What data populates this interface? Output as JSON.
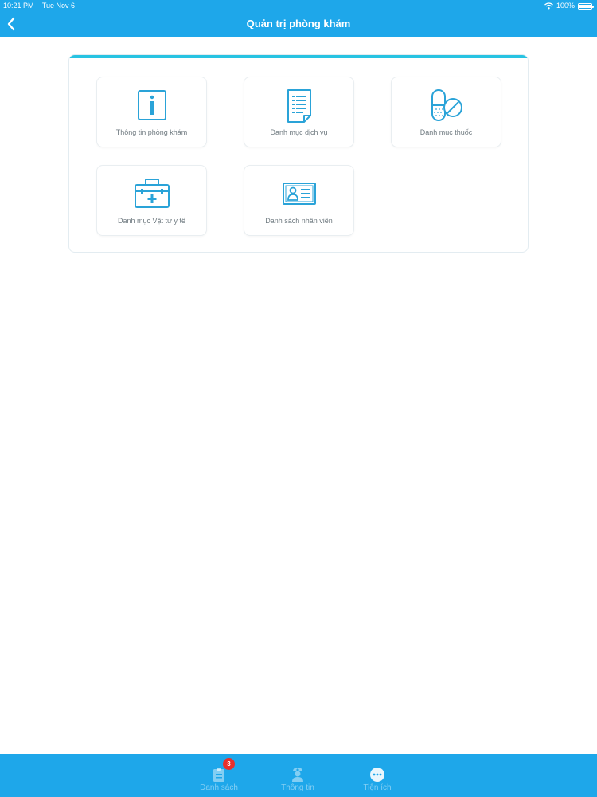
{
  "status": {
    "time": "10:21 PM",
    "date": "Tue Nov 6",
    "battery": "100%"
  },
  "header": {
    "title": "Quản trị phòng khám",
    "back_icon": "chevron-left-icon"
  },
  "colors": {
    "primary": "#1ea7ea",
    "accent": "#27c3e2",
    "badge": "#e8302c"
  },
  "menu": {
    "items": [
      {
        "label": "Thông tin phòng khám",
        "icon": "info-icon"
      },
      {
        "label": "Danh mục dịch vụ",
        "icon": "document-list-icon"
      },
      {
        "label": "Danh mục thuốc",
        "icon": "pill-icon"
      },
      {
        "label": "Danh mục Vật tư y tế",
        "icon": "medical-kit-icon"
      },
      {
        "label": "Danh sách nhân viên",
        "icon": "id-card-icon"
      }
    ]
  },
  "tabs": [
    {
      "label": "Danh sách",
      "icon": "clipboard-icon",
      "badge": "3"
    },
    {
      "label": "Thông tin",
      "icon": "nurse-icon"
    },
    {
      "label": "Tiện ích",
      "icon": "more-icon"
    }
  ]
}
